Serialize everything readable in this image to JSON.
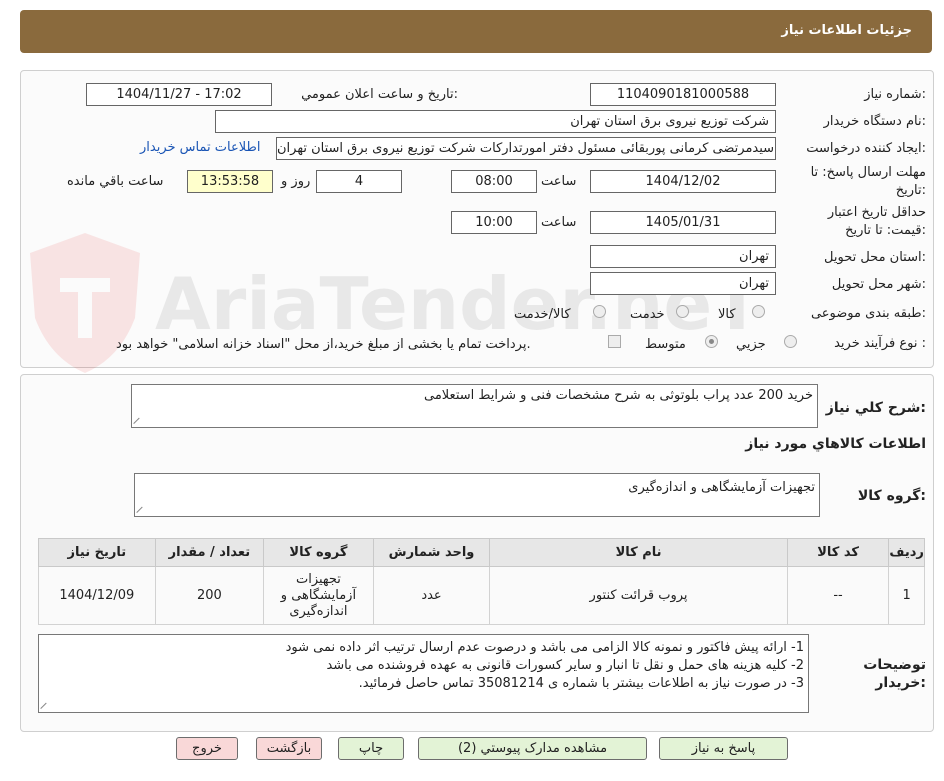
{
  "header": {
    "title": "جزئیات اطلاعات نیاز"
  },
  "watermark": {
    "text": "AriaTender.neT"
  },
  "fields": {
    "need_number_label": "شماره نیاز:",
    "need_number": "1104090181000588",
    "announce_label": "تاریخ و ساعت اعلان عمومي:",
    "announce_value": "1404/11/27 - 17:02",
    "buyer_org_label": "نام دستگاه خریدار:",
    "buyer_org": "شرکت توزیع نیروی برق استان تهران",
    "creator_label": "ایجاد کننده درخواست:",
    "creator": "سیدمرتضی کرمانی پوربقائی مسئول دفتر امورتدارکات شرکت توزیع نیروی برق استان تهران",
    "contact_link": "اطلاعات تماس خریدار",
    "deadline_label_1": "مهلت ارسال پاسخ: تا",
    "deadline_label_2": "تاریخ:",
    "deadline_date": "1404/12/02",
    "time_label": "ساعت",
    "deadline_time": "08:00",
    "days_value": "4",
    "days_label": "روز و",
    "remaining_time": "13:53:58",
    "remaining_label": "ساعت باقي مانده",
    "validity_label_1": "حداقل تاریخ اعتبار",
    "validity_label_2": "قیمت: تا تاریخ:",
    "validity_date": "1405/01/31",
    "validity_time": "10:00",
    "province_label": "استان محل تحویل:",
    "province": "تهران",
    "city_label": "شهر محل تحویل:",
    "city": "تهران",
    "category_label": "طبقه بندی موضوعی:",
    "category_options": [
      "کالا",
      "خدمت",
      "کالا/خدمت"
    ],
    "category_selected": "کالا",
    "process_label": "نوع فرآیند خرید :",
    "process_options": [
      "جزیي",
      "متوسط"
    ],
    "process_selected": "متوسط",
    "payment_note": "پرداخت تمام یا بخشی از مبلغ خرید،از محل \"اسناد خزانه اسلامی\" خواهد بود."
  },
  "summary": {
    "label": "شرح کلي نیاز:",
    "text": "خرید 200 عدد پراب بلوتوثی به شرح مشخصات فنی و شرایط استعلامی",
    "goods_info_title": "اطلاعات کالاهاي مورد نیاز",
    "goods_group_label": "گروه کالا:",
    "goods_group": "تجهیزات آزمایشگاهی و اندازه‌گیری"
  },
  "table": {
    "headers": [
      "ردیف",
      "کد کالا",
      "نام کالا",
      "واحد شمارش",
      "گروه کالا",
      "تعداد / مقدار",
      "تاریخ نیاز"
    ],
    "rows": [
      [
        "1",
        "--",
        "پروب قرائت کنتور",
        "عدد",
        "تجهیزات آزمایشگاهی و اندازه‌گیری",
        "200",
        "1404/12/09"
      ]
    ]
  },
  "buyer_notes": {
    "label_1": "توضیحات",
    "label_2": "خریدار:",
    "lines": [
      "1- ارائه پیش فاکتور و نمونه کالا الزامی می باشد و درصوت عدم ارسال ترتیب اثر داده نمی شود",
      "2- کلیه هزینه های حمل و نقل تا انبار و سایر کسورات قانونی به عهده فروشنده می باشد",
      "3- در صورت نیاز به اطلاعات بیشتر با شماره ی 35081214 تماس حاصل فرمائید."
    ]
  },
  "buttons": {
    "reply": "پاسخ به نیاز",
    "attachments": "مشاهده مدارک پیوستي (2)",
    "print": "چاپ",
    "back": "بازگشت",
    "exit": "خروج"
  }
}
